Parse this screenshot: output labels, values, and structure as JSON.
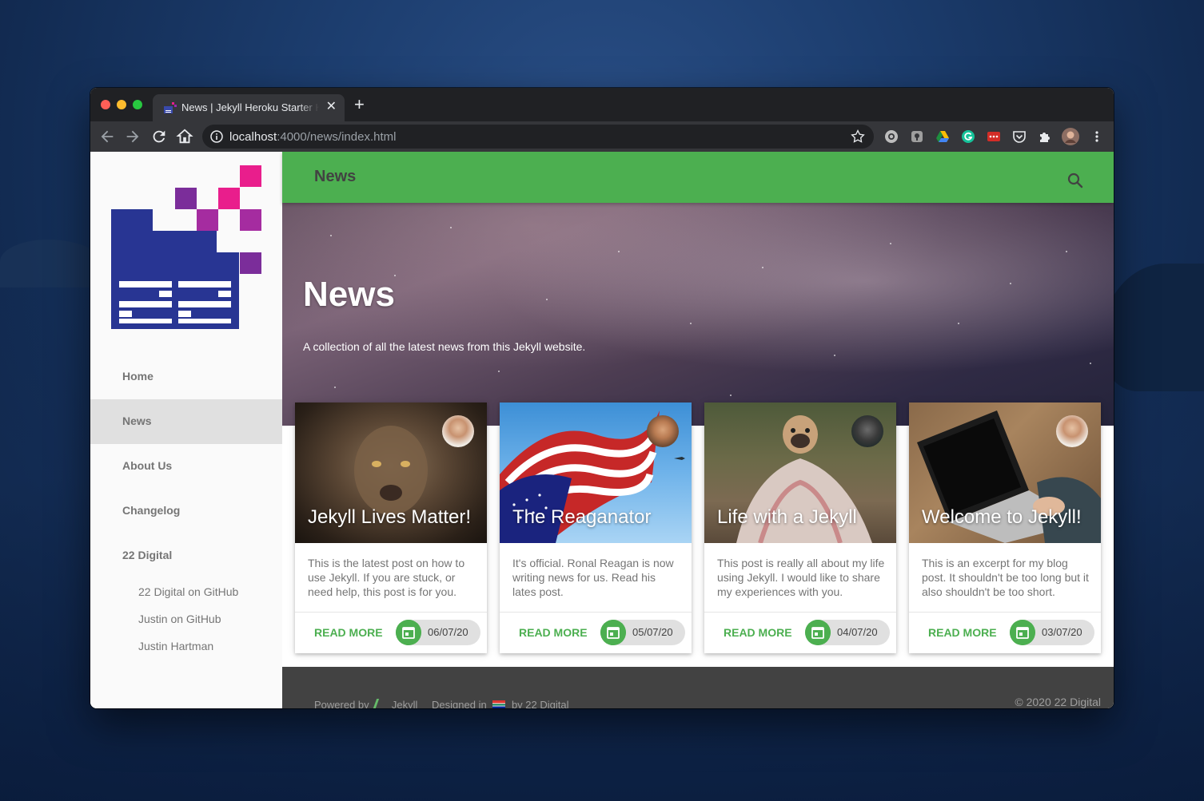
{
  "browser": {
    "tab_title": "News | Jekyll Heroku Starter Kit",
    "new_tab": "+",
    "close": "✕",
    "url_host": "localhost",
    "url_rest": ":4000/news/index.html"
  },
  "sidebar": {
    "items": [
      {
        "label": "Home"
      },
      {
        "label": "News"
      },
      {
        "label": "About Us"
      },
      {
        "label": "Changelog"
      },
      {
        "label": "22 Digital"
      }
    ],
    "sub_items": [
      {
        "label": "22 Digital on GitHub"
      },
      {
        "label": "Justin on GitHub"
      },
      {
        "label": "Justin Hartman"
      }
    ]
  },
  "appbar": {
    "title": "News"
  },
  "hero": {
    "title": "News",
    "subtitle": "A collection of all the latest news from this Jekyll website."
  },
  "cards": [
    {
      "title": "Jekyll Lives Matter!",
      "excerpt": "This is the latest post on how to use Jekyll. If you are stuck, or need help, this post is for you.",
      "action": "READ MORE",
      "date": "06/07/20"
    },
    {
      "title": "The Reaganator",
      "excerpt": "It's official. Ronal Reagan is now writing news for us. Read his lates post.",
      "action": "READ MORE",
      "date": "05/07/20"
    },
    {
      "title": "Life with a Jekyll",
      "excerpt": "This post is really all about my life using Jekyll. I would like to share my experiences with you.",
      "action": "READ MORE",
      "date": "04/07/20"
    },
    {
      "title": "Welcome to Jekyll!",
      "excerpt": "This is an excerpt for my blog post. It shouldn't be too long but it also shouldn't be too short.",
      "action": "READ MORE",
      "date": "03/07/20"
    }
  ],
  "footer": {
    "powered_by": "Powered by",
    "jekyll": "Jekyll",
    "designed_in": "Designed in",
    "by": "by 22 Digital",
    "copyright": "© 2020 22 Digital"
  },
  "colors": {
    "primary": "#4caf50",
    "sidebar_active": "#e0e0e0",
    "logo_blue": "#283593",
    "logo_purple": "#7b2d9a",
    "logo_magenta": "#e91e8c"
  }
}
